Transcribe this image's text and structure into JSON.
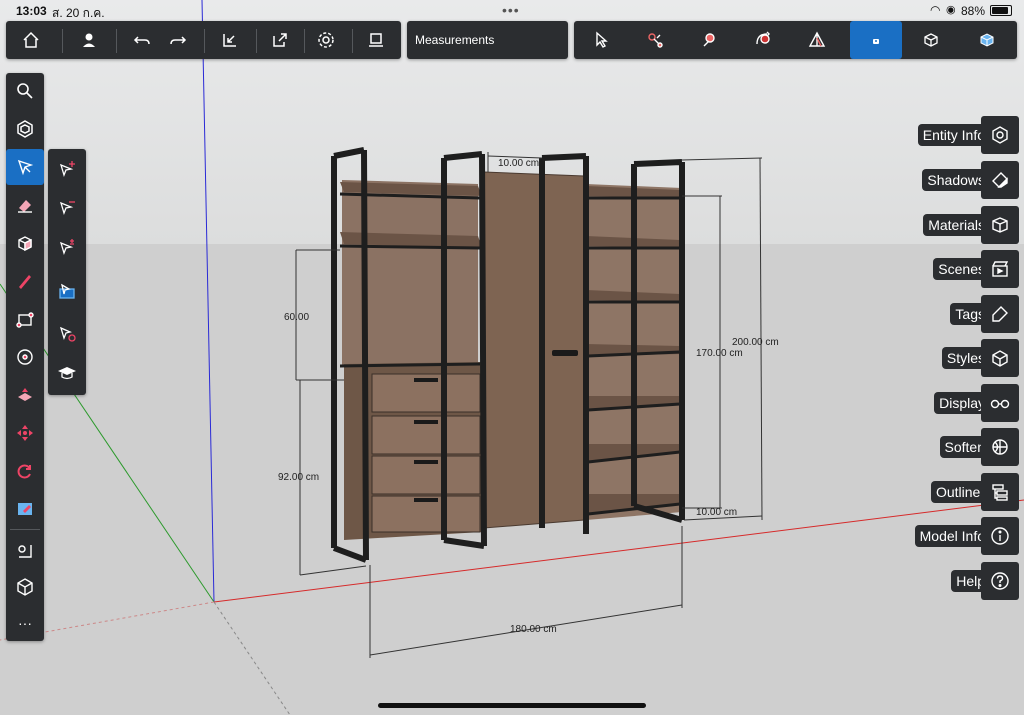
{
  "status_bar": {
    "time": "13:03",
    "date": "ส. 20 ก.ค.",
    "battery": "88%"
  },
  "toolbar": {
    "measurements_label": "Measurements",
    "left_icons": [
      "home-icon",
      "user-icon",
      "undo-icon",
      "redo-icon",
      "import-icon",
      "export-icon",
      "settings-icon",
      "layout-icon"
    ],
    "right_icons": [
      "select-icon",
      "lasso-select-icon",
      "paint-bucket-icon",
      "orbit-icon",
      "section-plane-icon",
      "xray-icon",
      "component-icon",
      "3d-view-icon"
    ],
    "active_right_index": 5
  },
  "left_toolbar": {
    "icons": [
      "search-icon",
      "component-icon",
      "select-icon",
      "eraser-icon",
      "box-icon",
      "pencil-icon",
      "rectangle-icon",
      "circle-icon",
      "push-pull-icon",
      "move-icon",
      "rotate-icon",
      "paint-icon",
      "tape-measure-icon",
      "orbit-view-icon",
      "more-icon"
    ],
    "active_index": 2
  },
  "flyout": {
    "icons": [
      "select-add-icon",
      "select-subtract-icon",
      "select-toggle-icon",
      "select-all-icon",
      "select-none-icon",
      "learn-icon"
    ]
  },
  "right_tray": {
    "items": [
      {
        "label": "Entity Info",
        "icon": "entity-info-icon"
      },
      {
        "label": "Shadows",
        "icon": "shadows-icon"
      },
      {
        "label": "Materials",
        "icon": "materials-icon"
      },
      {
        "label": "Scenes",
        "icon": "scenes-icon"
      },
      {
        "label": "Tags",
        "icon": "tags-icon"
      },
      {
        "label": "Styles",
        "icon": "styles-icon"
      },
      {
        "label": "Display",
        "icon": "display-icon"
      },
      {
        "label": "Soften",
        "icon": "soften-icon"
      },
      {
        "label": "Outliner",
        "icon": "outliner-icon"
      },
      {
        "label": "Model Info",
        "icon": "model-info-icon"
      },
      {
        "label": "Help",
        "icon": "help-icon"
      }
    ]
  },
  "dimensions": {
    "top": "10.00 cm",
    "left_upper": "60.00",
    "left_lower": "92.00 cm",
    "right_inner": "170.00 cm",
    "right_outer": "200.00 cm",
    "bottom_small": "10.00 cm",
    "bottom": "180.00 cm"
  },
  "colors": {
    "wood": "#7d6350",
    "wood_dark": "#5f4a3c",
    "frame": "#2a2a2a",
    "accent": "#1a6fc4",
    "panel": "#2b2d30"
  }
}
